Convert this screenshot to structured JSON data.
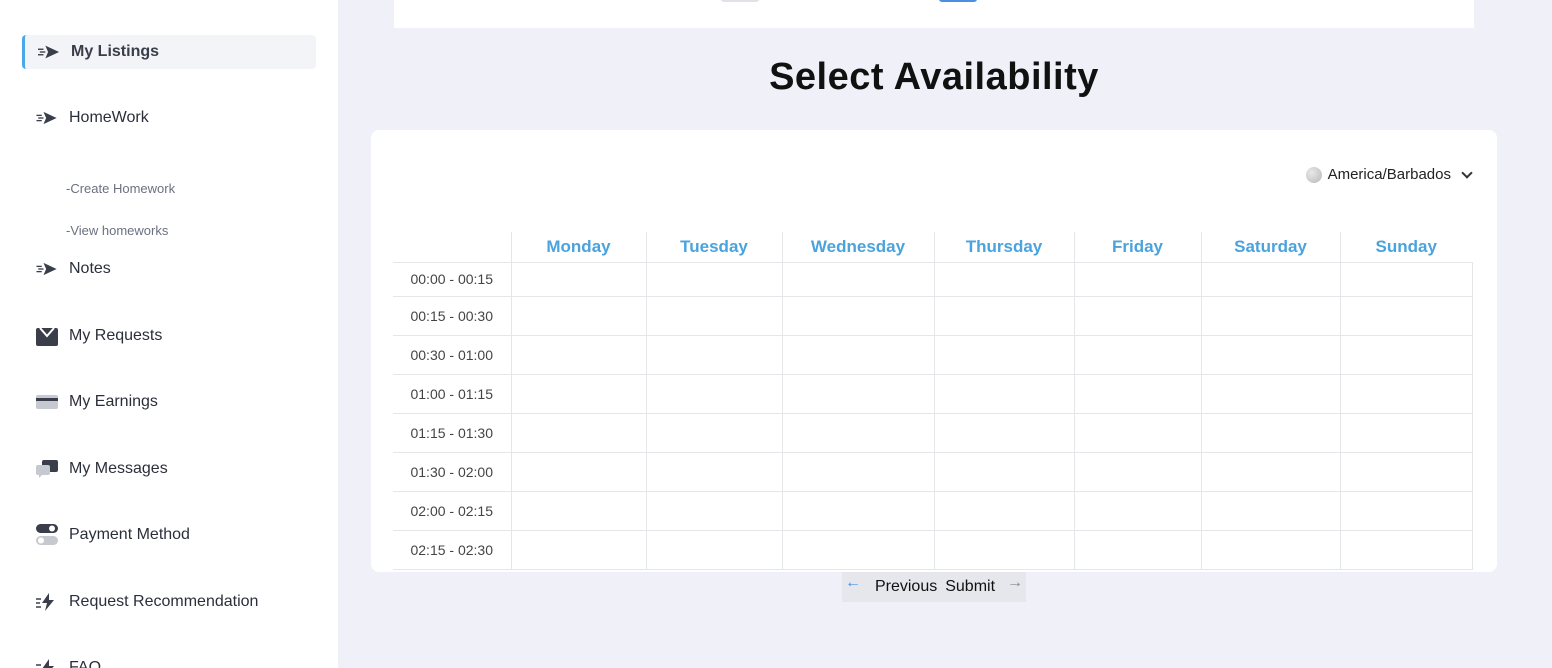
{
  "sidebar": {
    "items": [
      {
        "label": "My Listings",
        "icon": "send-icon"
      },
      {
        "label": "HomeWork",
        "icon": "send-icon"
      },
      {
        "label": "-Create Homework"
      },
      {
        "label": "-View homeworks"
      },
      {
        "label": "Notes",
        "icon": "send-icon"
      },
      {
        "label": "My Requests",
        "icon": "inbox-icon"
      },
      {
        "label": "My Earnings",
        "icon": "card-icon"
      },
      {
        "label": "My Messages",
        "icon": "chat-icon"
      },
      {
        "label": "Payment Method",
        "icon": "toggle-icon"
      },
      {
        "label": "Request Recommendation",
        "icon": "bolt-icon"
      },
      {
        "label": "FAQ",
        "icon": "bolt-icon"
      }
    ]
  },
  "page": {
    "title": "Select Availability"
  },
  "timezone": {
    "value": "America/Barbados"
  },
  "calendar": {
    "days": [
      "Monday",
      "Tuesday",
      "Wednesday",
      "Thursday",
      "Friday",
      "Saturday",
      "Sunday"
    ],
    "slots": [
      "00:00 - 00:15",
      "00:15 - 00:30",
      "00:30 - 01:00",
      "01:00 - 01:15",
      "01:15 - 01:30",
      "01:30 - 02:00",
      "02:00 - 02:15",
      "02:15 - 02:30"
    ]
  },
  "nav": {
    "previous": "Previous",
    "submit": "Submit"
  },
  "colors": {
    "accent": "#4aa3dc",
    "background": "#f0f0f8"
  }
}
